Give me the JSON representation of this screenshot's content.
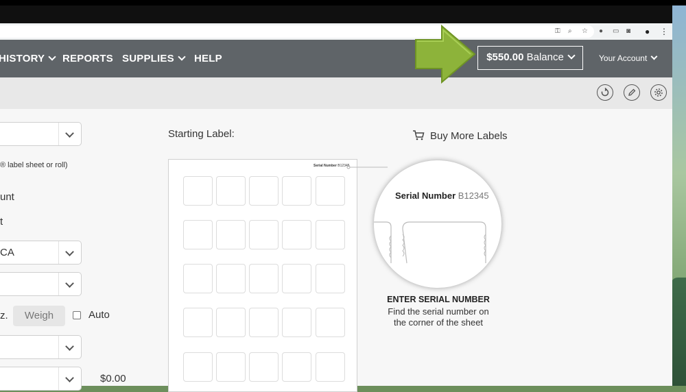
{
  "nav": {
    "items": [
      {
        "label": "HISTORY",
        "dropdown": true
      },
      {
        "label": "REPORTS",
        "dropdown": false
      },
      {
        "label": "SUPPLIES",
        "dropdown": true
      },
      {
        "label": "HELP",
        "dropdown": false
      }
    ],
    "balance_amount": "$550.00",
    "balance_word": "Balance",
    "account_label": "Your Account"
  },
  "toolbar": {
    "icons": [
      "refresh-icon",
      "pencil-icon",
      "gear-icon"
    ]
  },
  "form": {
    "label_type_note": "® label sheet or roll)",
    "row_label_1": "unt",
    "row_label_2": "t",
    "state_value": "CA",
    "weight_unit": "z.",
    "weigh_button": "Weigh",
    "auto_label": "Auto",
    "total_value": "$0.00"
  },
  "sheet": {
    "starting_label": "Starting Label:",
    "buy_more": "Buy More Labels",
    "tiny_serial_label": "Serial Number",
    "tiny_serial_value": "B12345",
    "serial_label": "Serial Number",
    "serial_value": "B12345",
    "caption_title": "ENTER SERIAL NUMBER",
    "caption_line1": "Find the serial number on",
    "caption_line2": "the corner of the sheet"
  },
  "colors": {
    "navbar": "#5f6468",
    "arrow": "#8db33a",
    "toolbar": "#e8e8e8"
  }
}
